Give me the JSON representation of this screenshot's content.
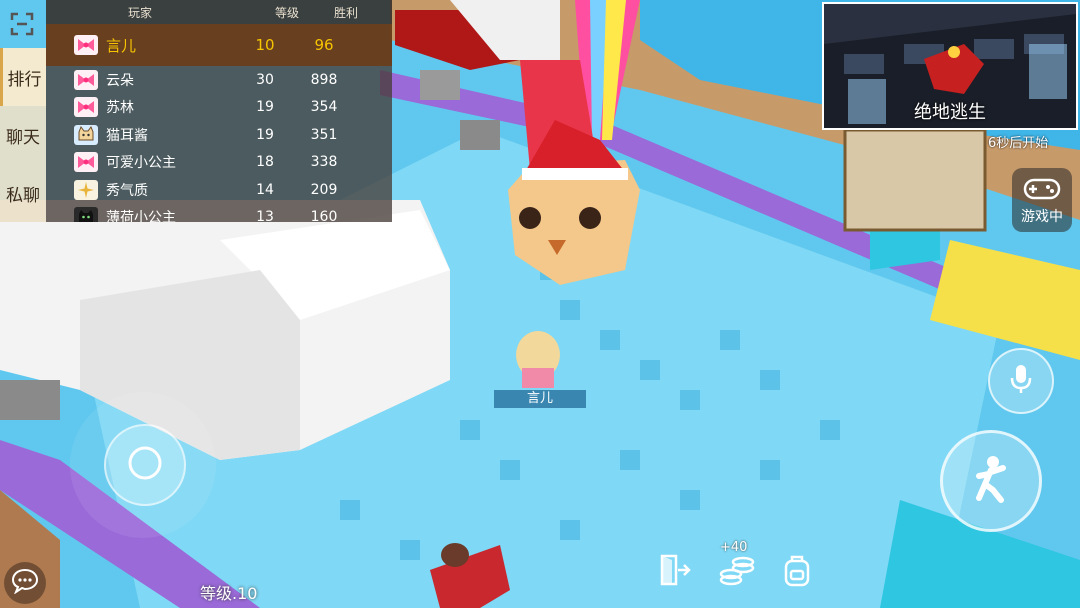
{
  "leaderboard": {
    "headers": {
      "player": "玩家",
      "level": "等级",
      "wins": "胜利"
    },
    "me": {
      "name": "言儿",
      "level": "10",
      "wins": "96",
      "avatar": "pink-bow-icon"
    },
    "rows": [
      {
        "name": "云朵",
        "level": "30",
        "wins": "898",
        "avatar": "pink-bow-icon"
      },
      {
        "name": "苏林",
        "level": "19",
        "wins": "354",
        "avatar": "pink-bow-icon"
      },
      {
        "name": "猫耳酱",
        "level": "19",
        "wins": "351",
        "avatar": "cat-icon"
      },
      {
        "name": "可爱小公主",
        "level": "18",
        "wins": "338",
        "avatar": "pink-bow-icon"
      },
      {
        "name": "秀气质",
        "level": "14",
        "wins": "209",
        "avatar": "sparkle-icon"
      },
      {
        "name": "薄荷小公主",
        "level": "13",
        "wins": "160",
        "avatar": "black-cat-icon"
      }
    ]
  },
  "side_tabs": [
    "排行",
    "聊天",
    "私聊"
  ],
  "minimap": {
    "title": "绝地逃生"
  },
  "countdown": "6秒后开始",
  "game_status_button": {
    "label": "游戏中",
    "icon": "gamepad-icon"
  },
  "player_name_tag": "言儿",
  "bottom": {
    "level_text": "等级.10",
    "coin_bonus": "+40"
  },
  "colors": {
    "accent_gold": "#f6c400",
    "water": "#5fc4ea",
    "purple_rim": "#9a6ad8",
    "yellow_block": "#f5e04a"
  }
}
